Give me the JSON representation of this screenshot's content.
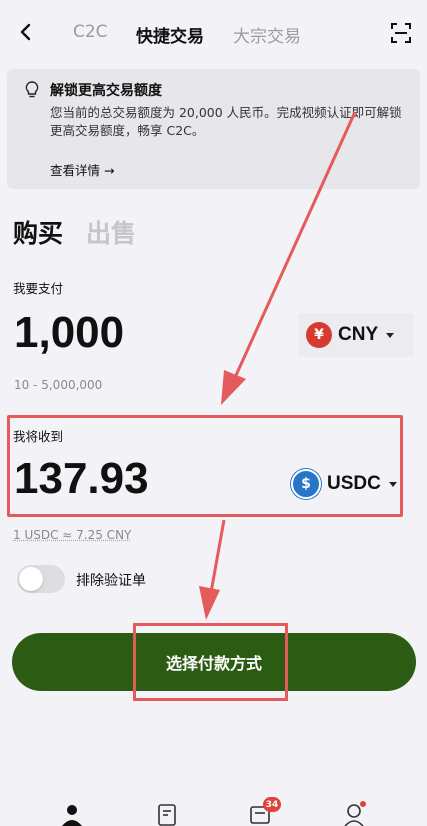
{
  "header": {
    "tabs": [
      {
        "label": "C2C"
      },
      {
        "label": "快捷交易"
      },
      {
        "label": "大宗交易"
      }
    ]
  },
  "notice": {
    "title": "解锁更高交易额度",
    "body": "您当前的总交易额度为 20,000 人民币。完成视频认证即可解锁更高交易额度，畅享 C2C。",
    "link": "查看详情 →"
  },
  "trade_tabs": {
    "buy": "购买",
    "sell": "出售"
  },
  "pay": {
    "label": "我要支付",
    "amount": "1,000",
    "currency": "CNY",
    "currency_symbol": "¥",
    "currency_color": "#d73b30",
    "range": "10 - 5,000,000"
  },
  "receive": {
    "label": "我将收到",
    "amount": "137.93",
    "currency": "USDC",
    "currency_symbol": "$",
    "currency_color": "#2775ca"
  },
  "rate": "1 USDC ≈ 7.25 CNY",
  "filter": {
    "label": "排除验证单",
    "enabled": false
  },
  "action": {
    "label": "选择付款方式",
    "color": "#2c5c13"
  },
  "nav": {
    "messages_badge": "34"
  },
  "annotation_color": "#e55a5a"
}
